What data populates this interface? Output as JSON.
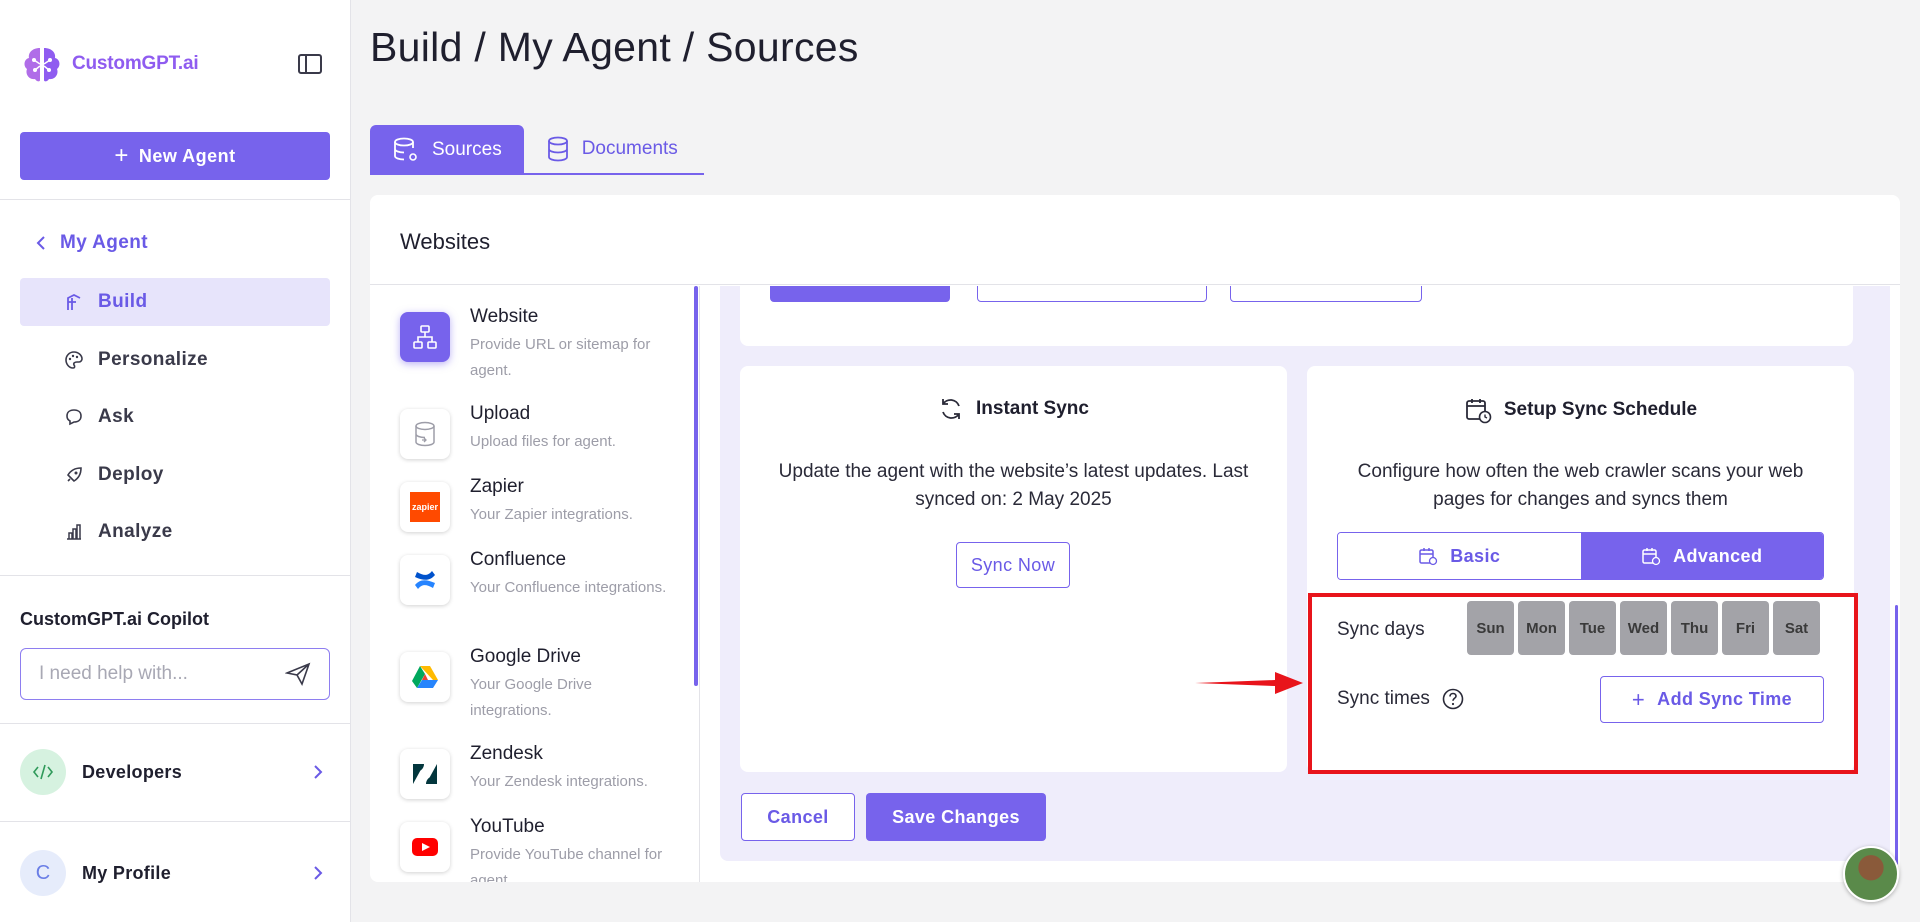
{
  "brand": {
    "name": "CustomGPT.ai"
  },
  "sidebar": {
    "new_agent_label": "New Agent",
    "back_label": "My Agent",
    "items": [
      {
        "label": "Build",
        "icon": "build-icon",
        "active": true
      },
      {
        "label": "Personalize",
        "icon": "palette-icon",
        "active": false
      },
      {
        "label": "Ask",
        "icon": "chat-icon",
        "active": false
      },
      {
        "label": "Deploy",
        "icon": "rocket-icon",
        "active": false
      },
      {
        "label": "Analyze",
        "icon": "bar-chart-icon",
        "active": false
      }
    ],
    "copilot": {
      "title": "CustomGPT.ai Copilot",
      "placeholder": "I need help with..."
    },
    "developers_label": "Developers",
    "profile": {
      "label": "My Profile",
      "initial": "C"
    }
  },
  "header": {
    "title": "Build / My Agent / Sources"
  },
  "tabs": [
    {
      "label": "Sources",
      "active": true
    },
    {
      "label": "Documents",
      "active": false
    }
  ],
  "card": {
    "title": "Websites"
  },
  "sources": [
    {
      "title": "Website",
      "desc": "Provide URL or sitemap for agent.",
      "icon": "sitemap-icon"
    },
    {
      "title": "Upload",
      "desc": "Upload files for agent.",
      "icon": "database-icon"
    },
    {
      "title": "Zapier",
      "desc": "Your Zapier integrations.",
      "icon": "zapier-icon",
      "icon_text": "zapier"
    },
    {
      "title": "Confluence",
      "desc": "Your Confluence integrations.",
      "icon": "confluence-icon"
    },
    {
      "title": "Google Drive",
      "desc": "Your Google Drive integrations.",
      "icon": "google-drive-icon"
    },
    {
      "title": "Zendesk",
      "desc": "Your Zendesk integrations.",
      "icon": "zendesk-icon"
    },
    {
      "title": "YouTube",
      "desc": "Provide YouTube channel for agent.",
      "icon": "youtube-icon"
    }
  ],
  "instant_sync": {
    "title": "Instant Sync",
    "text": "Update the agent with the website’s latest updates. Last synced on: 2 May 2025",
    "button": "Sync Now"
  },
  "schedule": {
    "title": "Setup Sync Schedule",
    "text": "Configure how often the web crawler scans your web pages for changes and syncs them",
    "modes": {
      "basic": "Basic",
      "advanced": "Advanced",
      "selected": "Advanced"
    },
    "days_label": "Sync days",
    "days": [
      "Sun",
      "Mon",
      "Tue",
      "Wed",
      "Thu",
      "Fri",
      "Sat"
    ],
    "times_label": "Sync times",
    "add_time_label": "Add Sync Time"
  },
  "actions": {
    "cancel": "Cancel",
    "save": "Save Changes"
  },
  "colors": {
    "accent": "#7763ec",
    "highlight": "#e8141b",
    "brand": "#8f5cf0"
  }
}
